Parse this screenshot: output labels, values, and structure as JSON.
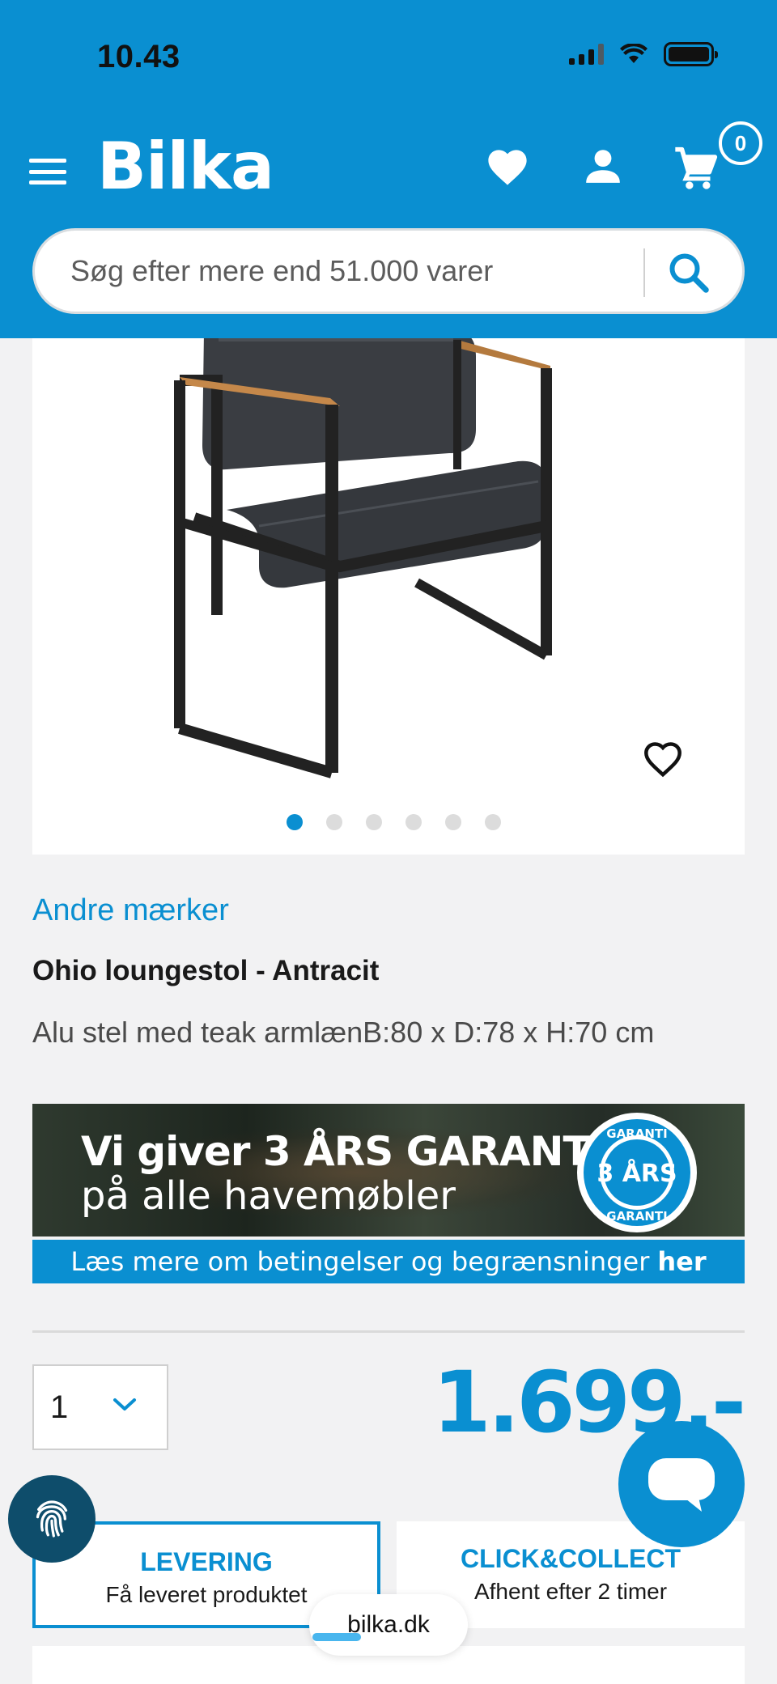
{
  "status": {
    "time": "10.43"
  },
  "header": {
    "logo": "Bilka",
    "cart_count": "0",
    "search_placeholder": "Søg efter mere end 51.000 varer"
  },
  "gallery": {
    "image_count": 6,
    "active_index": 0
  },
  "product": {
    "brand": "Andre mærker",
    "title": "Ohio loungestol - Antracit",
    "description": "Alu stel med teak armlænB:80 x D:78 x H:70 cm",
    "quantity": "1",
    "price": "1.699,-"
  },
  "banner": {
    "line1": "Vi giver 3 ÅRS GARANTI",
    "line2": "på alle havemøbler",
    "seal_top": "GARANTI",
    "seal_mid": "3 ÅRS",
    "seal_bottom": "GARANTI",
    "footer_text": "Læs mere om betingelser og begrænsninger",
    "footer_link": "her"
  },
  "options": {
    "delivery_title": "LEVERING",
    "delivery_sub": "Få leveret produktet",
    "collect_title": "CLICK&COLLECT",
    "collect_sub": "Afhent efter 2 timer"
  },
  "browser": {
    "url": "bilka.dk"
  },
  "icons": [
    "menu-icon",
    "heart-icon",
    "user-icon",
    "cart-icon",
    "search-icon",
    "favorite-icon",
    "chevron-down-icon",
    "chat-icon",
    "fingerprint-icon"
  ],
  "colors": {
    "brand_blue": "#0a8fd1",
    "background": "#f2f2f3",
    "text": "#1a1a1a"
  }
}
